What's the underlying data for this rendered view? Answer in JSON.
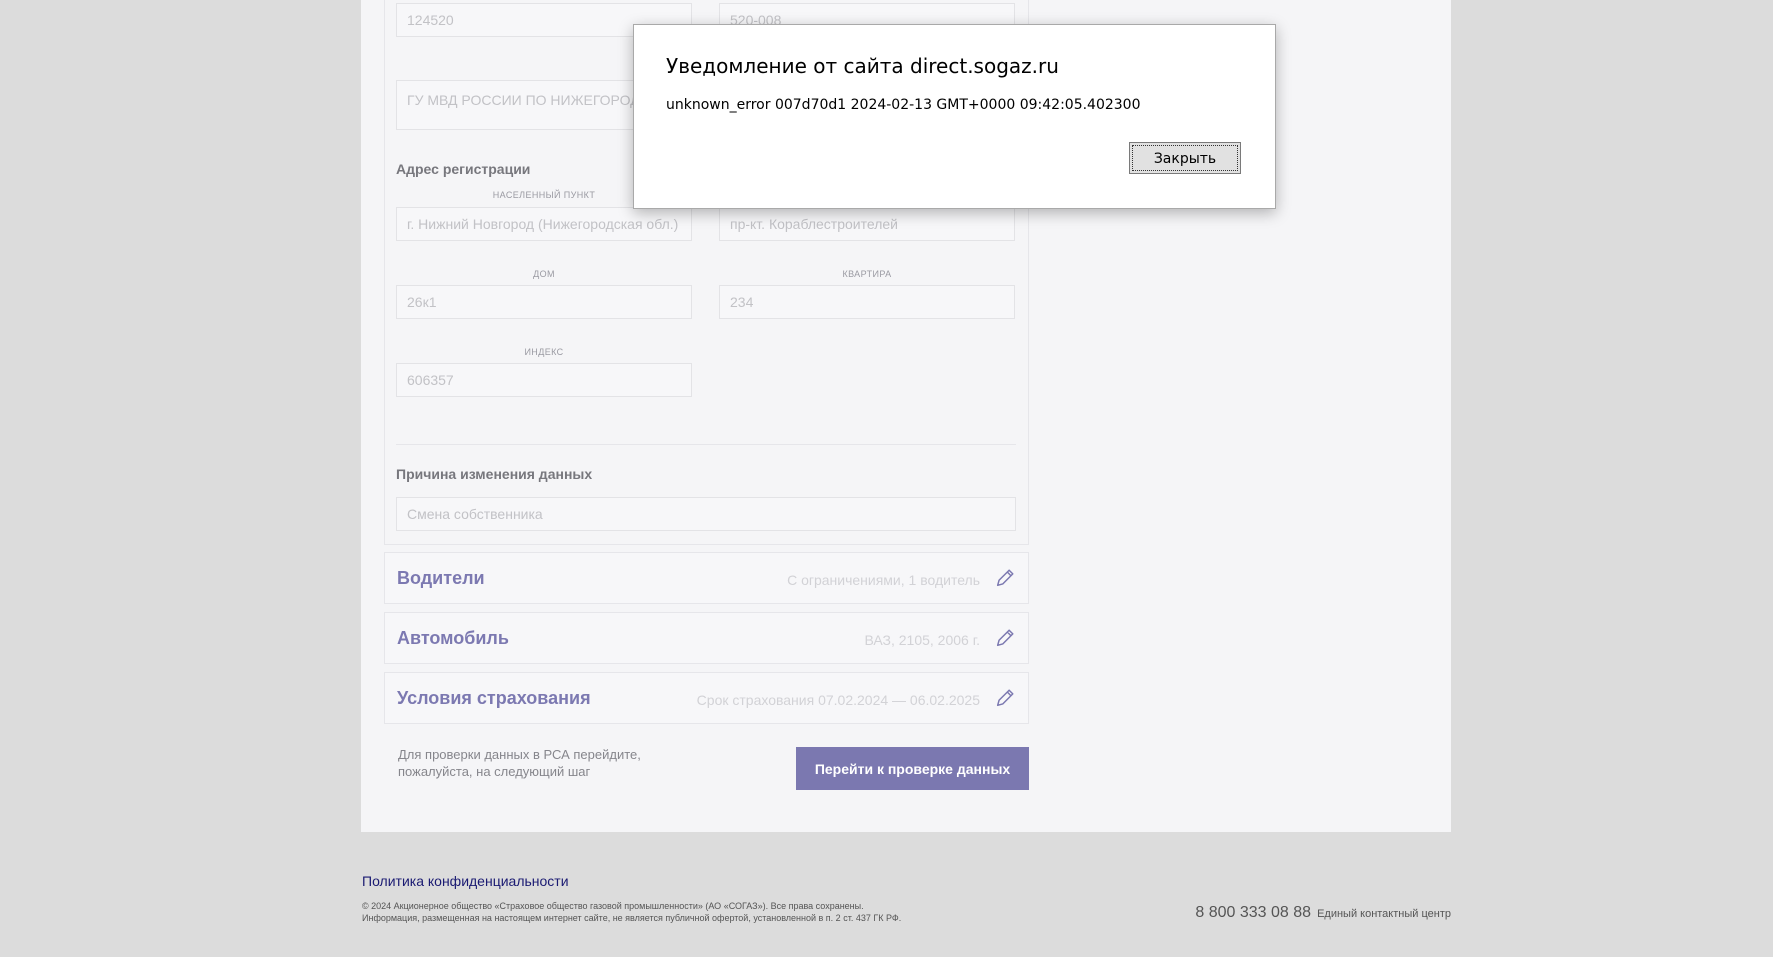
{
  "passport": {
    "issuer_code_value": "124520",
    "department_code_value": "520-008",
    "issued_by_value": "ГУ МВД РОССИИ ПО НИЖЕГОРОДСКОЙ ОБЛАСТИ"
  },
  "registration_address": {
    "heading": "Адрес регистрации",
    "locality_label": "НАСЕЛЕННЫЙ ПУНКТ",
    "locality_value": "г. Нижний Новгород (Нижегородская обл.)",
    "street_value": "пр-кт. Кораблестроителей",
    "house_label": "ДОМ",
    "house_value": "26к1",
    "apartment_label": "КВАРТИРА",
    "apartment_value": "234",
    "index_label": "ИНДЕКС",
    "index_value": "606357"
  },
  "change_reason": {
    "heading": "Причина изменения данных",
    "value": "Смена собственника"
  },
  "sections": [
    {
      "title": "Водители",
      "summary": "С ограничениями, 1 водитель"
    },
    {
      "title": "Автомобиль",
      "summary": "ВАЗ, 2105, 2006 г."
    },
    {
      "title": "Условия страхования",
      "summary": "Срок страхования 07.02.2024 — 06.02.2025"
    }
  ],
  "next_step": {
    "hint": "Для проверки данных в РСА перейдите, пожалуйста, на следующий шаг",
    "button_label": "Перейти к проверке данных"
  },
  "footer": {
    "privacy_link": "Политика конфиденциальности",
    "copyright": "© 2024 Акционерное общество «Страховое общество газовой промышленности» (АО «СОГАЗ»). Все права сохранены.",
    "disclaimer": "Информация, размещенная на настоящем интернет сайте, не является публичной офертой, установленной в п. 2 ст. 437 ГК РФ.",
    "phone": "8 800 333 08 88",
    "phone_caption": "Единый контактный центр"
  },
  "dialog": {
    "title": "Уведомление от сайта direct.sogaz.ru",
    "message": "unknown_error 007d70d1 2024-02-13 GMT+0000 09:42:05.402300",
    "close_label": "Закрыть"
  },
  "colors": {
    "accent": "#7b78b0",
    "page_background": "#dcdcdc",
    "link": "#1a1a72"
  },
  "icons": {
    "edit": "pencil-icon"
  }
}
